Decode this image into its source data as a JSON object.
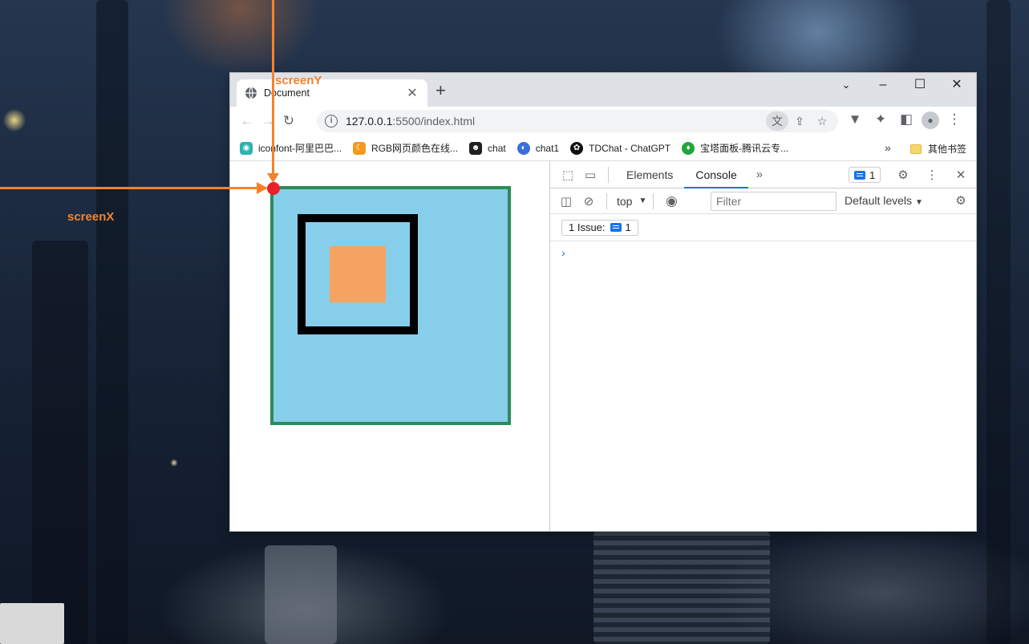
{
  "annotations": {
    "screen_y_label": "screenY",
    "screen_x_label": "screenX",
    "arrow_color": "#f5822a",
    "origin_dot_color": "#e8202a"
  },
  "browser": {
    "tab_title": "Document",
    "tab_icon": "globe-icon",
    "url_host": "127.0.0.1",
    "url_path": ":5500/index.html",
    "bookmarks": [
      {
        "label": "iconfont-阿里巴巴...",
        "icon": "iconfont-icon"
      },
      {
        "label": "RGB网页颜色在线...",
        "icon": "moon-icon"
      },
      {
        "label": "chat",
        "icon": "chat-avatar-icon"
      },
      {
        "label": "chat1",
        "icon": "chat1-icon"
      },
      {
        "label": "TDChat - ChatGPT",
        "icon": "openai-icon"
      },
      {
        "label": "宝塔面板-腾讯云专...",
        "icon": "shield-icon"
      }
    ],
    "bookmarks_more": "»",
    "other_bookmarks": "其他书签"
  },
  "page": {
    "outer_box_bg": "#87ceeb",
    "outer_box_border": "#2e8b57",
    "middle_box_border": "#000000",
    "inner_box_bg": "#f4a460"
  },
  "devtools": {
    "tabs": [
      "Elements",
      "Console"
    ],
    "active_tab": "Console",
    "issue_count": "1",
    "context": "top",
    "filter_placeholder": "Filter",
    "levels": "Default levels",
    "issues_label": "1 Issue:",
    "issues_count": "1",
    "prompt": "›"
  }
}
